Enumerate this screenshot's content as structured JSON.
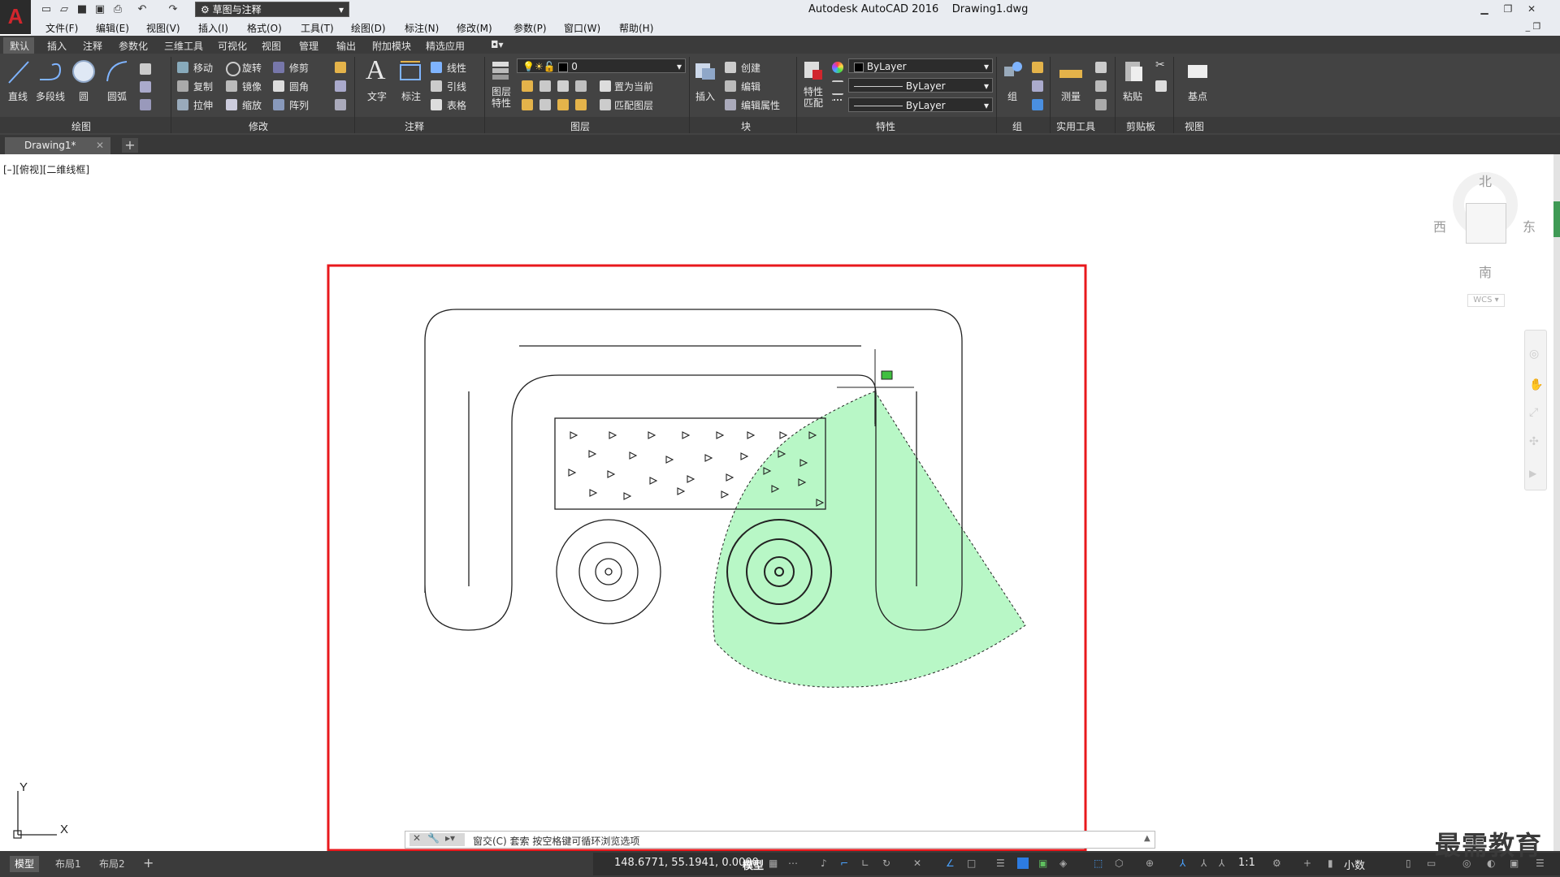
{
  "app": {
    "title": "Autodesk AutoCAD 2016    Drawing1.dwg",
    "workspace": "草图与注释",
    "logo_letter": "A"
  },
  "menu": [
    "文件(F)",
    "编辑(E)",
    "视图(V)",
    "插入(I)",
    "格式(O)",
    "工具(T)",
    "绘图(D)",
    "标注(N)",
    "修改(M)",
    "参数(P)",
    "窗口(W)",
    "帮助(H)"
  ],
  "ribbon_tabs": [
    "默认",
    "插入",
    "注释",
    "参数化",
    "三维工具",
    "可视化",
    "视图",
    "管理",
    "输出",
    "附加模块",
    "精选应用"
  ],
  "ribbon": {
    "draw": {
      "line": "直线",
      "polyline": "多段线",
      "circle": "圆",
      "arc": "圆弧",
      "title": "绘图"
    },
    "modify": {
      "move": "移动",
      "rotate": "旋转",
      "trim": "修剪",
      "copy": "复制",
      "mirror": "镜像",
      "fillet": "圆角",
      "stretch": "拉伸",
      "scale": "缩放",
      "array": "阵列",
      "title": "修改"
    },
    "annotation": {
      "text": "文字",
      "dimension": "标注",
      "linear": "线性",
      "leader": "引线",
      "table": "表格",
      "title": "注释"
    },
    "layers": {
      "layer_props": "图层\n特性",
      "current_layer": "0",
      "set_current": "置为当前",
      "match_layer": "匹配图层",
      "title": "图层"
    },
    "block": {
      "insert": "插入",
      "create": "创建",
      "edit": "编辑",
      "edit_attr": "编辑属性",
      "title": "块"
    },
    "properties": {
      "match": "特性\n匹配",
      "color": "ByLayer",
      "linetype": "ByLayer",
      "lineweight": "ByLayer",
      "title": "特性"
    },
    "groups": {
      "group": "组",
      "title": "组"
    },
    "utilities": {
      "measure": "测量",
      "title": "实用工具"
    },
    "clipboard": {
      "paste": "粘贴",
      "title": "剪贴板"
    },
    "view": {
      "base": "基点",
      "title": "视图"
    }
  },
  "file_tab": "Drawing1*",
  "viewport_label": "[–][俯视][二维线框]",
  "viewcube": {
    "north": "北",
    "south": "南",
    "east": "东",
    "west": "西",
    "wcs": "WCS"
  },
  "command_line": "窗交(C)  套索  按空格键可循环浏览选项",
  "status": {
    "layout_tabs": [
      "模型",
      "布局1",
      "布局2"
    ],
    "coords": "148.6771, 55.1941, 0.0000",
    "model": "模型",
    "scale": "1:1",
    "units": "小数"
  },
  "watermark": "最需教育",
  "colors": {
    "selection_fill": "#b8f7c6",
    "highlight_frame": "#e8181c",
    "ribbon_bg": "#434343"
  }
}
